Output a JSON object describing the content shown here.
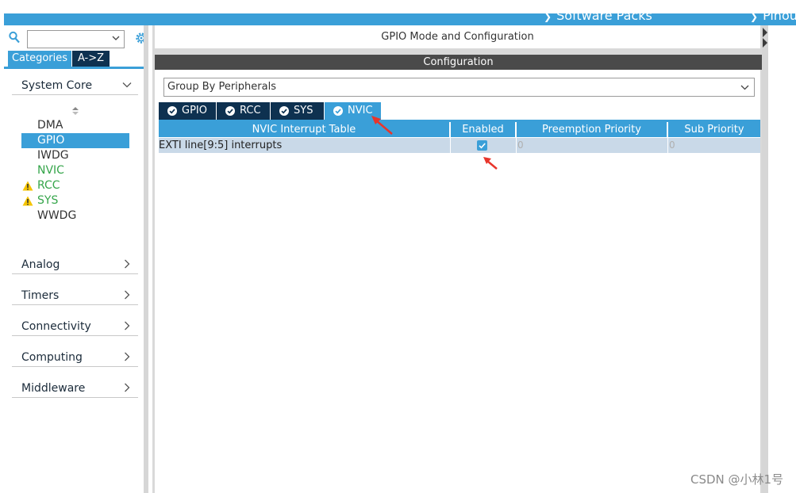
{
  "topbar": {
    "items": [
      "Software Packs",
      "Pinou"
    ]
  },
  "left": {
    "search": {
      "value": "",
      "placeholder": ""
    },
    "category_tabs": {
      "active": "Categories",
      "other": "A->Z"
    },
    "sections": {
      "system_core": "System Core",
      "analog": "Analog",
      "timers": "Timers",
      "connectivity": "Connectivity",
      "computing": "Computing",
      "middleware": "Middleware"
    },
    "peripherals": [
      "DMA",
      "GPIO",
      "IWDG",
      "NVIC",
      "RCC",
      "SYS",
      "WWDG"
    ],
    "selected_peripheral": "GPIO"
  },
  "main": {
    "mode_title": "GPIO Mode and Configuration",
    "config_title": "Configuration",
    "group_select": "Group By Peripherals",
    "tabs": [
      "GPIO",
      "RCC",
      "SYS",
      "NVIC"
    ],
    "active_tab": "NVIC",
    "table": {
      "headers": [
        "NVIC Interrupt Table",
        "Enabled",
        "Preemption Priority",
        "Sub Priority"
      ],
      "rows": [
        {
          "name": "EXTI line[9:5] interrupts",
          "enabled": true,
          "preemption": "0",
          "sub": "0"
        }
      ]
    }
  },
  "colors": {
    "accent": "#3a9fd8",
    "dark_tab": "#0e3150",
    "config_bar": "#4a4a4a",
    "warning": "#f5c400",
    "green_text": "#35a54a",
    "annotation_arrow": "#e8352b"
  },
  "watermark": "CSDN @小林1号"
}
